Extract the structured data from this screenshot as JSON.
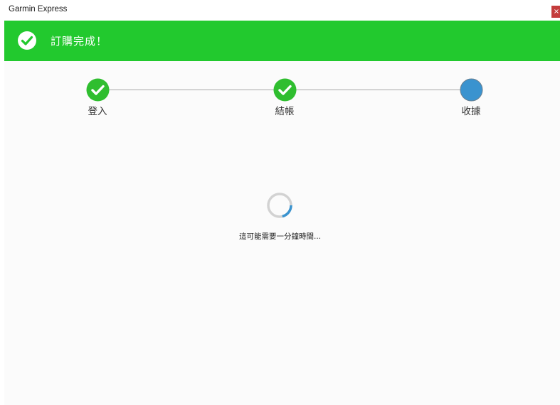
{
  "window": {
    "title": "Garmin Express",
    "close_label": "×"
  },
  "banner": {
    "message": "訂購完成！",
    "icon": "check-circle-icon",
    "color": "#22c92e"
  },
  "stepper": {
    "steps": [
      {
        "label": "登入",
        "status": "complete"
      },
      {
        "label": "結帳",
        "status": "complete"
      },
      {
        "label": "收據",
        "status": "current"
      }
    ],
    "complete_color": "#2fbe2f",
    "current_color": "#3a93cf"
  },
  "loading": {
    "message": "這可能需要一分鐘時間...",
    "icon": "loading-spinner-icon",
    "accent_color": "#3a93cf"
  }
}
